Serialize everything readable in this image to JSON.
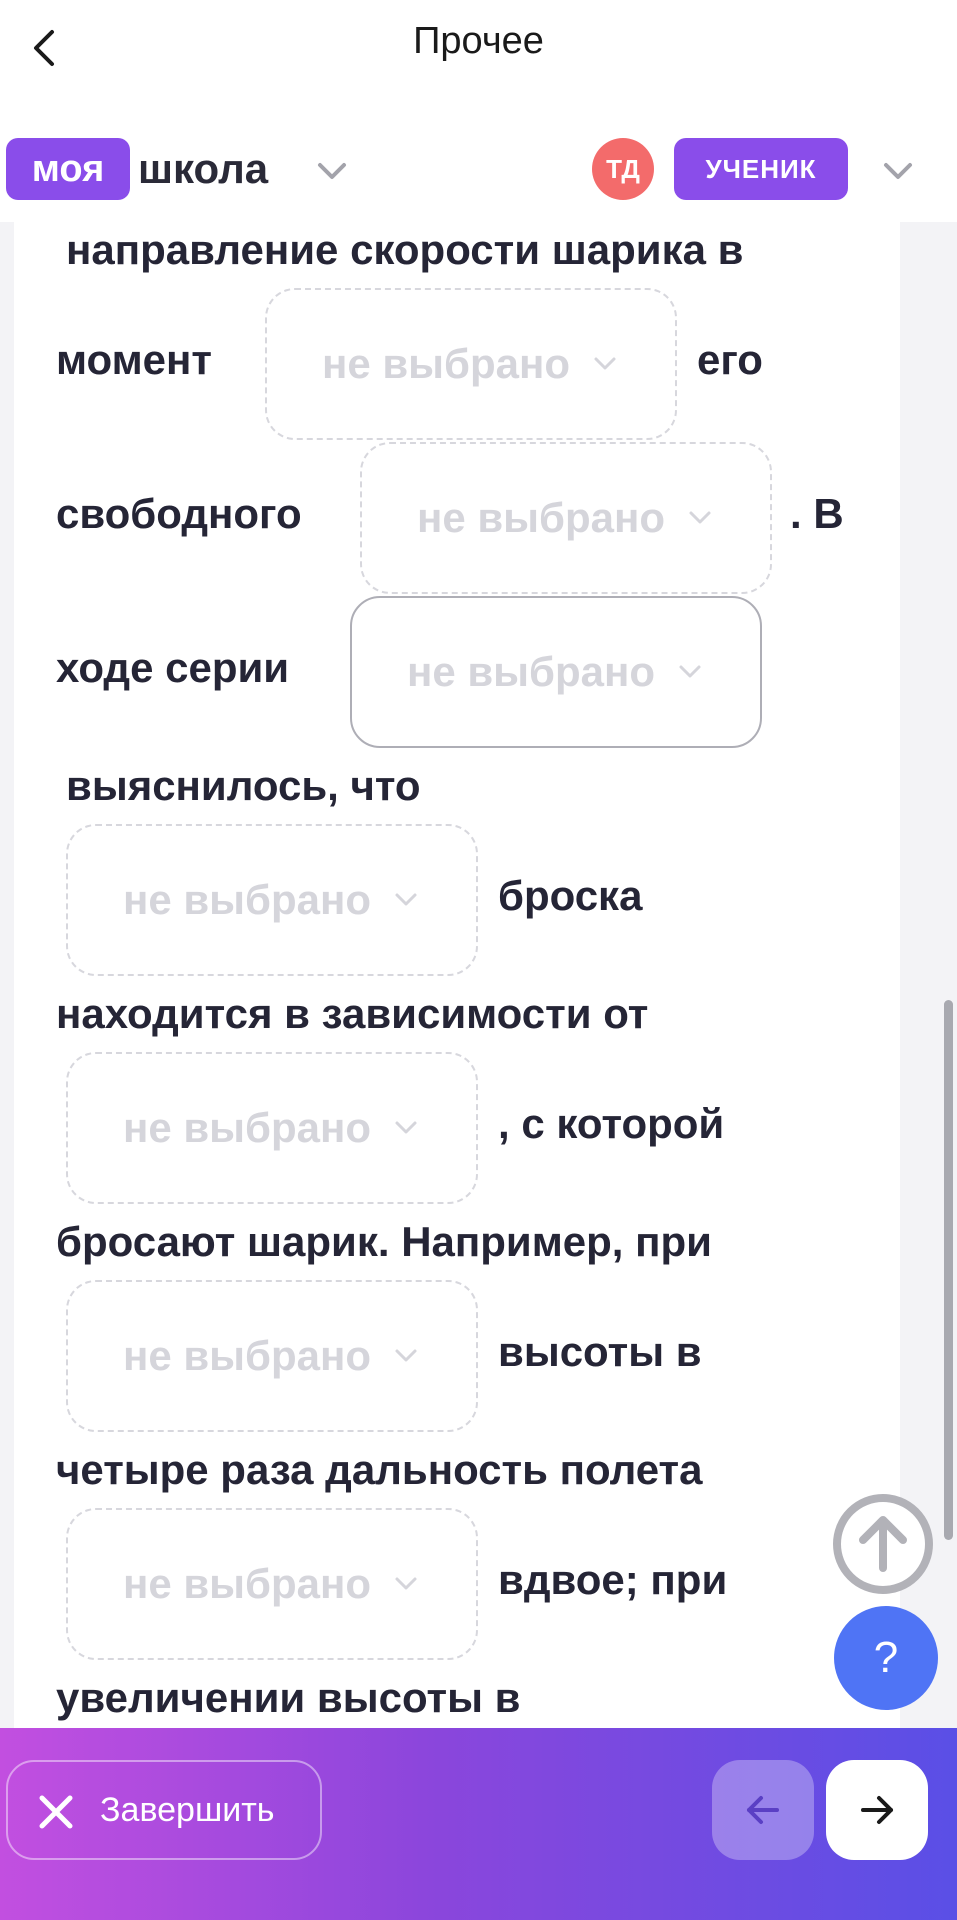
{
  "header": {
    "title": "Прочее"
  },
  "brand": {
    "logo_box": "моя",
    "logo_word": "школа",
    "avatar_initials": "ТД",
    "role": "УЧЕНИК"
  },
  "content": {
    "line1": "направление скорости шарика в",
    "line2": "момент",
    "line2_after": "его",
    "line3": "свободного",
    "line3_after": ". В",
    "line4": "ходе серии",
    "line5": "выяснилось, что",
    "line6_after": "броска",
    "line7": "находится в зависимости от",
    "line8_after": ", с которой",
    "line9": "бросают шарик. Например, при",
    "line10_after": "высоты в",
    "line11": "четыре раза дальность полета",
    "line12_after": "вдвое; при",
    "line13": "увеличении высоты в",
    "select_placeholder": "не выбрано"
  },
  "fab": {
    "help_label": "?"
  },
  "footer": {
    "finish_label": "Завершить"
  },
  "colors": {
    "brand": "#8a4dea",
    "avatar": "#f36b6b",
    "help": "#4f74f5",
    "text": "#252536",
    "placeholder": "#d5d5db"
  }
}
